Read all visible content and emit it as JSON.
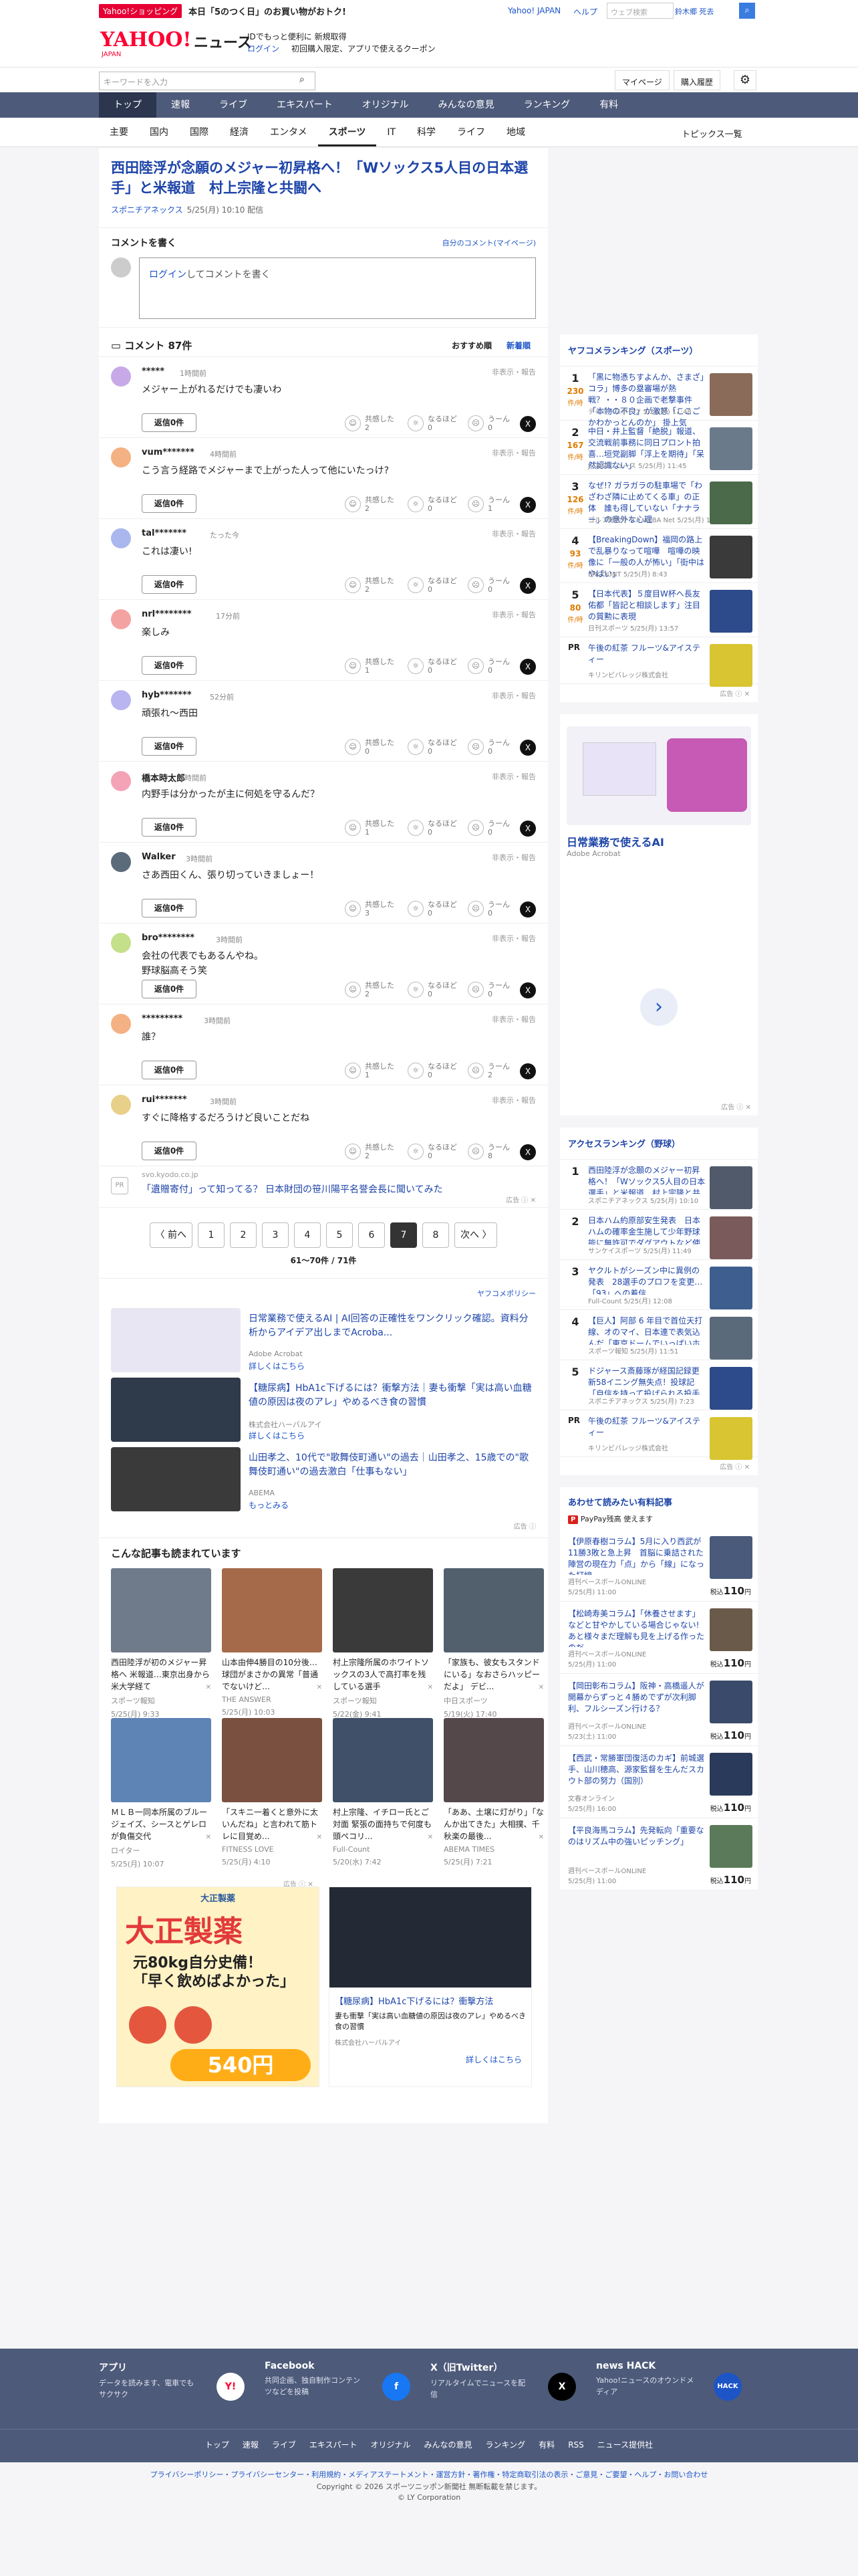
{
  "top": {
    "shop_badge": "Yahoo!ショッピング",
    "shop_msg": "本日「5のつく日」のお買い物がおトク!",
    "yj_link": "Yahoo! JAPAN",
    "help_link": "ヘルプ",
    "search_placeholder": "ウェブ検索",
    "user": "鈴木郷 死去"
  },
  "header": {
    "logo": "YAHOO!",
    "logo_sub": "JAPAN",
    "news": "ニュース",
    "promo1": "IDでもっと便利に 新規取得",
    "login": "ログイン",
    "promo2": "初回購入限定、アプリで使えるクーポン"
  },
  "searchbar": {
    "placeholder": "キーワードを入力",
    "mypage": "マイページ",
    "history": "購入履歴"
  },
  "gnav": [
    "トップ",
    "速報",
    "ライブ",
    "エキスパート",
    "オリジナル",
    "みんなの意見",
    "ランキング",
    "有料"
  ],
  "snav": [
    "主要",
    "国内",
    "国際",
    "経済",
    "エンタメ",
    "スポーツ",
    "IT",
    "科学",
    "ライフ",
    "地域"
  ],
  "topics_list": "トピックス一覧",
  "article": {
    "title": "西田陸浮が念願のメジャー初昇格へ！「Wソックス5人目の日本選手」と米報道　村上宗隆と共闘へ",
    "source": "スポニチアネックス",
    "date": "5/25(月) 10:10 配信"
  },
  "comment_write": {
    "heading": "コメントを書く",
    "my_comments": "自分のコメント(マイページ)",
    "box_login": "ログイン",
    "box_rest": "してコメントを書く"
  },
  "comments_header": {
    "title": "コメント 87件",
    "sort_recommended": "おすすめ順",
    "sort_new": "新着順"
  },
  "comment_labels": {
    "report": "非表示・報告",
    "reply": "返信0件",
    "kyokan": "共感した",
    "naruhodo": "なるほど",
    "uun": "うーん"
  },
  "comments": [
    {
      "user": "*****",
      "time": "1時間前",
      "text": "メジャー上がれるだけでも凄いわ",
      "kyokan": "2",
      "naruhodo": "0",
      "uun": "0",
      "color": "#c8a9e8"
    },
    {
      "user": "vum*******",
      "time": "4時間前",
      "text": "こう言う経路でメジャーまで上がった人って他にいたっけ?",
      "kyokan": "2",
      "naruhodo": "0",
      "uun": "1",
      "color": "#f4b183"
    },
    {
      "user": "tal*******",
      "time": "たった今",
      "text": "これは凄い!",
      "kyokan": "2",
      "naruhodo": "0",
      "uun": "0",
      "color": "#a9b7ee"
    },
    {
      "user": "nrl********",
      "time": "17分前",
      "text": "楽しみ",
      "kyokan": "1",
      "naruhodo": "0",
      "uun": "0",
      "color": "#f4a3a3"
    },
    {
      "user": "hyb*******",
      "time": "52分前",
      "text": "頑張れ〜西田",
      "kyokan": "0",
      "naruhodo": "0",
      "uun": "0",
      "color": "#b9b5f0"
    },
    {
      "user": "橋本時太郎",
      "time": "3時間前",
      "text": "内野手は分かったが主に何処を守るんだ？",
      "kyokan": "1",
      "naruhodo": "0",
      "uun": "0",
      "color": "#f4a3b7"
    },
    {
      "user": "Walker",
      "time": "3時間前",
      "text": "さあ西田くん、張り切っていきましょー！",
      "kyokan": "3",
      "naruhodo": "0",
      "uun": "0",
      "color": "#5b6b7a"
    },
    {
      "user": "bro********",
      "time": "3時間前",
      "text": "会社の代表でもあるんやね。\n野球脳高そう笑",
      "kyokan": "2",
      "naruhodo": "0",
      "uun": "0",
      "color": "#c4e08a"
    },
    {
      "user": "*********",
      "time": "3時間前",
      "text": "誰？",
      "kyokan": "1",
      "naruhodo": "0",
      "uun": "2",
      "color": "#f4b183"
    },
    {
      "user": "rui*******",
      "time": "3時間前",
      "text": "すぐに降格するだろうけど良いことだね",
      "kyokan": "2",
      "naruhodo": "0",
      "uun": "8",
      "color": "#e8d08a"
    }
  ],
  "ad_row": {
    "domain": "svo.kyodo.co.jp",
    "text": "「遺贈寄付」って知ってる？ 日本財団の笹川陽平名誉会長に聞いてみた",
    "badge": "広告 ⓘ ✕"
  },
  "pager": {
    "prev": "〈 前へ",
    "pages": [
      "1",
      "2",
      "3",
      "4",
      "5",
      "6",
      "7",
      "8"
    ],
    "current": "7",
    "next": "次へ 〉",
    "count": "61〜70件 / 71件"
  },
  "yahoo_policy": "ヤフコメポリシー",
  "sponsored": [
    {
      "title": "日常業務で使えるAI | AI回答の正確性をワンクリック確認。資料分析からアイデア出しまでAcroba...",
      "source": "Adobe Acrobat",
      "link": "詳しくはこちら",
      "color": "#e9e6f4"
    },
    {
      "title": "【糖尿病】HbA1c下げるには？衝撃方法｜妻も衝撃「実は高い血糖値の原因は夜のアレ」やめるべき食の習慣",
      "source": "株式会社ハーバルアイ",
      "link": "詳しくはこちら",
      "color": "#2f3a4a"
    },
    {
      "title": "山田孝之、10代で\"歌舞伎町通い\"の過去｜山田孝之、15歳での\"歌舞伎町通い\"の過去激白「仕事もない」",
      "source": "ABEMA",
      "link": "もっとみる",
      "color": "#3a3a3a"
    }
  ],
  "sponsored_badge": "広告 ⓘ",
  "recommend": {
    "heading": "こんな記事も読まれています",
    "items": [
      {
        "title": "西田陸浮が初のメジャー昇格へ 米報道…東京出身から米大学経て",
        "source": "スポーツ報知",
        "date": "5/25(月) 9:33",
        "color": "#6f7a8a"
      },
      {
        "title": "山本由伸4勝目の10分後…球団がまさかの異常「普通でないけど…",
        "source": "THE ANSWER",
        "date": "5/25(月) 10:03",
        "color": "#a46a4a"
      },
      {
        "title": "村上宗隆所属のホワイトソックスの3人で高打率を残している選手",
        "source": "スポーツ報知",
        "date": "5/22(金) 9:41",
        "color": "#3a3a3a"
      },
      {
        "title": "「家族も、彼女もスタンドにいる」なおさらハッピーだよ」 デビ...",
        "source": "中日スポーツ",
        "date": "5/19(火) 17:40",
        "color": "#52606e"
      },
      {
        "title": "ＭＬＢ一同本所属のブルージェイズ、シースとゲレロが負傷交代",
        "source": "ロイター",
        "date": "5/25(月) 10:07",
        "color": "#5e84b6"
      },
      {
        "title": "「スキニ一着くと意外に太いんだね」と言われて筋トレに目覚め...",
        "source": "FITNESS LOVE",
        "date": "5/25(月) 4:10",
        "color": "#7a5040"
      },
      {
        "title": "村上宗隆、イチロー氏とご対面 緊張の面持ちで何度も頭ペコリ...",
        "source": "Full-Count",
        "date": "5/20(水) 7:42",
        "color": "#3f5068"
      },
      {
        "title": "「ああ、土壌に灯がり」「なんか出てきた」大相撲、千秋楽の最後...",
        "source": "ABEMA TIMES",
        "date": "5/25(月) 7:21",
        "color": "#55484a"
      }
    ],
    "close": "✕"
  },
  "bigad": {
    "badge": "広告 ⓘ ✕",
    "a_head": "大正製薬",
    "a_big": "大正製薬",
    "a_mid": "元80kg自分史備！\n「早く飲めばよかった」",
    "a_price": "540円",
    "b_title": "【糖尿病】HbA1c下げるには？衝撃方法",
    "b_desc": "妻も衝撃「実は高い血糖値の原因は夜のアレ」やめるべき食の習慣",
    "b_src": "株式会社ハーバルアイ",
    "b_link": "詳しくはこちら"
  },
  "side_rank": {
    "heading": "ヤフコメランキング（スポーツ）",
    "items": [
      {
        "rank": "1",
        "num": "230",
        "unit": "件/時",
        "title": "「黒に物憑ちすよんか、さまざ」コラ」博多の塁審場が熱戦？・・８０企画で老撃事件「本物の不良」が激怒「ここごかわかっとんのか」 掛上気",
        "src": "デイリースポーツ",
        "date": "5/25(月) 11:48",
        "color": "#8a6b5a"
      },
      {
        "rank": "2",
        "num": "167",
        "unit": "件/時",
        "title": "中日・井上監督「絶脱」報道、交流戦前事務に同日プロント拍喜…垣党副脚「浮上を期待」「呆然認識ない」",
        "src": "J-CASTニュース",
        "date": "5/25(月) 11:45",
        "color": "#6b7a8a"
      },
      {
        "rank": "3",
        "num": "126",
        "unit": "件/時",
        "title": "なぜ!? ガラガラの駐車場で「わざわざ隣に止めてくる車」の正体　誰も得していない「ナナラー」の意外な心理",
        "src": "ゴルフ総合サイト ALBA Net",
        "date": "5/25(月) 11:00",
        "color": "#4a6a4a"
      },
      {
        "rank": "4",
        "num": "93",
        "unit": "件/時",
        "title": "【BreakingDown】福岡の路上で乱暴りなって喧嘩　喧嘩の映像に「一般の人が怖い」「街中はやばい」",
        "src": "ENCOUNT",
        "date": "5/25(月) 8:43",
        "color": "#3a3a3a"
      },
      {
        "rank": "5",
        "num": "80",
        "unit": "件/時",
        "title": "【日本代表】５度目W杯へ長友佑都「皆記と相談します」注目の質勲に表現",
        "src": "日刊スポーツ",
        "date": "5/25(月) 13:57",
        "color": "#2d4a8a"
      }
    ],
    "pr_label": "PR",
    "pr_title": "午後の紅茶 フルーツ&アイスティー",
    "pr_src": "キリンビバレッジ株式会社",
    "badge": "広告 ⓘ ✕"
  },
  "side_ad": {
    "title": "日常業務で使えるAI",
    "src": "Adobe Acrobat",
    "arrow": "›",
    "badge": "広告 ⓘ ✕"
  },
  "access_rank": {
    "heading": "アクセスランキング（野球）",
    "items": [
      {
        "rank": "1",
        "title": "西田陸浮が念願のメジャー初昇格へ！「Wソックス5人目の日本選手」と米報道　村上宗隆と共闘へ",
        "src": "スポニチアネックス",
        "date": "5/25(月) 10:10",
        "color": "#505a6a"
      },
      {
        "rank": "2",
        "title": "日本ハム約原部安生発表　日本ハムの確率金生施して少年野球能に無許可でダグアウトなど使反される問題に難し",
        "src": "サンケイスポーツ",
        "date": "5/25(月) 11:49",
        "color": "#7a5a5a"
      },
      {
        "rank": "3",
        "title": "ヤクルトがシーズン中に異例の発表　28選手のプロフを変更…「93」への着信",
        "src": "Full-Count",
        "date": "5/25(月) 12:08",
        "color": "#3d5e8e"
      },
      {
        "rank": "4",
        "title": "【巨人】阿部 6 年目で首位天打線、オのマイ、日本連で表気込んだ「東京ドームでいっぱいホームラン打ちます」２４日の試合中に全員起をたらそて別説を",
        "src": "スポーツ報知",
        "date": "5/25(月) 11:51",
        "color": "#5a6a7a"
      },
      {
        "rank": "5",
        "title": "ドジャース斎藤琢が経国記録更新58イニング無失点！投球記「自信を持って投げられる投手がたくさん」",
        "src": "スポニチアネックス",
        "date": "5/25(月) 7:23",
        "color": "#2d4a8a"
      }
    ],
    "pr_label": "PR",
    "pr_title": "午後の紅茶 フルーツ&アイスティー",
    "pr_src": "キリンビバレッジ株式会社",
    "badge": "広告 ⓘ ✕"
  },
  "paid": {
    "heading": "あわせて読みたい有料記事",
    "paypay_badge": "P",
    "paypay_text": "PayPay残高 使えます",
    "items": [
      {
        "title": "【伊原春樹コラム】5月に入り西武が11勝3敗と急上昇　首脳に乗詰された陣営の現在力「点」から「線」になった打線",
        "src": "週刊ベースボールONLINE",
        "date": "5/25(月) 11:00",
        "price": "110",
        "color": "#4a5a7a"
      },
      {
        "title": "【松崎寿美コラム】「休養させます」などと甘やかしている場合じゃない!あと様々まだ理解も見を上げる作ったのだ",
        "src": "週刊ベースボールONLINE",
        "date": "5/25(月) 11:00",
        "price": "110",
        "color": "#6a5a4a"
      },
      {
        "title": "【岡田彰布コラム】阪神・高橋遥人が開幕からずっと４勝めでずが次利脚利、フルシーズン行ける？",
        "src": "週刊ベースボールONLINE",
        "date": "5/23(土) 11:00",
        "price": "110",
        "color": "#3a4a6a"
      },
      {
        "title": "【西武・常勝軍団復活のカギ】前城選手、山川穂高、源家監督を生んだスカウト部の努力（国別）",
        "src": "文春オンライン",
        "date": "5/25(月) 16:00",
        "price": "110",
        "color": "#2a3a5a"
      },
      {
        "title": "【平良海馬コラム】先発転向「重要なのはリズム中の強いピッチング」",
        "src": "週刊ベースボールONLINE",
        "date": "5/25(月) 11:00",
        "price": "110",
        "color": "#5a7a5a"
      }
    ],
    "price_prefix": "税込",
    "price_suffix": "円"
  },
  "footer": {
    "cols": [
      {
        "h": "アプリ",
        "d": "データを読みます、電車でもサクサク",
        "ic": "Y!"
      },
      {
        "h": "Facebook",
        "d": "共同企画、独自制作コンテンツなどを投稿",
        "ic": "f"
      },
      {
        "h": "X（旧Twitter）",
        "d": "リアルタイムでニュースを配信",
        "ic": "X"
      },
      {
        "h": "news HACK",
        "d": "Yahoo!ニュースのオウンドメディア",
        "ic": "HACK"
      }
    ],
    "nav": [
      "トップ",
      "速報",
      "ライブ",
      "エキスパート",
      "オリジナル",
      "みんなの意見",
      "ランキング",
      "有料",
      "RSS",
      "ニュース提供社"
    ],
    "links": "プライバシーポリシー・プライバシーセンター・利用規約・メディアステートメント・運営方針・著作権・特定商取引法の表示・ご意見・ご要望・ヘルプ・お問い合わせ",
    "copy": "Copyright © 2026 スポーツニッポン新聞社 無断転載を禁じます。",
    "lyc": "© LY Corporation"
  },
  "colors": {
    "brand": "#ff0033",
    "link": "#1d44a8",
    "nav": "#4d5a7a"
  }
}
